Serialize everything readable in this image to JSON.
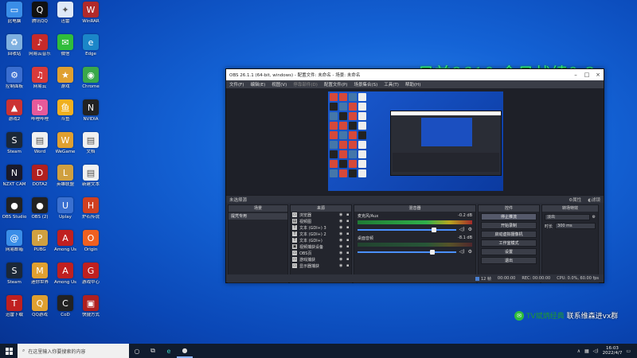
{
  "desktop_icons": [
    {
      "label": "此电脑",
      "color": "#3a8ee8",
      "glyph": "▭"
    },
    {
      "label": "腾讯QQ",
      "color": "#111111",
      "glyph": "Q"
    },
    {
      "label": "迅雷",
      "color": "#dfe9f7",
      "glyph": "✦"
    },
    {
      "label": "WinRAR",
      "color": "#b12a2a",
      "glyph": "W"
    },
    {
      "label": "回收站",
      "color": "#7fb0e0",
      "glyph": "♻"
    },
    {
      "label": "网易云音乐",
      "color": "#c62a2a",
      "glyph": "♪"
    },
    {
      "label": "微信",
      "color": "#2fbd3b",
      "glyph": "✉"
    },
    {
      "label": "Edge",
      "color": "#1b86c8",
      "glyph": "e"
    },
    {
      "label": "控制面板",
      "color": "#3a6ed0",
      "glyph": "⚙"
    },
    {
      "label": "网易云",
      "color": "#d83a3a",
      "glyph": "♫"
    },
    {
      "label": "游戏",
      "color": "#e0a030",
      "glyph": "★"
    },
    {
      "label": "Chrome",
      "color": "#3aa84a",
      "glyph": "◉"
    },
    {
      "label": "游戏2",
      "color": "#cc3333",
      "glyph": "▲"
    },
    {
      "label": "哔哩哔哩",
      "color": "#e65a9a",
      "glyph": "b"
    },
    {
      "label": "斗鱼",
      "color": "#f0b020",
      "glyph": "鱼"
    },
    {
      "label": "NVIDIA",
      "color": "#222222",
      "glyph": "N"
    },
    {
      "label": "Steam",
      "color": "#1b2838",
      "glyph": "S"
    },
    {
      "label": "Word",
      "color": "#f0f0f0",
      "glyph": "▤"
    },
    {
      "label": "WeGame",
      "color": "#e0a030",
      "glyph": "W"
    },
    {
      "label": "文档",
      "color": "#f0f0f0",
      "glyph": "▤"
    },
    {
      "label": "NZXT CAM",
      "color": "#1a1a2a",
      "glyph": "N"
    },
    {
      "label": "DOTA2",
      "color": "#b02020",
      "glyph": "D"
    },
    {
      "label": "英雄联盟",
      "color": "#d0a040",
      "glyph": "L"
    },
    {
      "label": "新建文本",
      "color": "#f0f0f0",
      "glyph": "▤"
    },
    {
      "label": "OBS Studio",
      "color": "#222222",
      "glyph": "●"
    },
    {
      "label": "OBS (2)",
      "color": "#222222",
      "glyph": "●"
    },
    {
      "label": "Uplay",
      "color": "#3a70d0",
      "glyph": "U"
    },
    {
      "label": "炉石传说",
      "color": "#d04020",
      "glyph": "H"
    },
    {
      "label": "网易邮箱",
      "color": "#3a8ee8",
      "glyph": "@"
    },
    {
      "label": "PUBG",
      "color": "#d0a040",
      "glyph": "P"
    },
    {
      "label": "Among Us",
      "color": "#c02020",
      "glyph": "A"
    },
    {
      "label": "Origin",
      "color": "#f06020",
      "glyph": "O"
    },
    {
      "label": "Steam",
      "color": "#1b2838",
      "glyph": "S"
    },
    {
      "label": "迷你世界",
      "color": "#e0a030",
      "glyph": "M"
    },
    {
      "label": "Among Us",
      "color": "#c02020",
      "glyph": "A"
    },
    {
      "label": "游戏中心",
      "color": "#c02020",
      "glyph": "G"
    },
    {
      "label": "迅雷下载",
      "color": "#c02020",
      "glyph": "T"
    },
    {
      "label": "QQ游戏",
      "color": "#e0a030",
      "glyph": "Q"
    },
    {
      "label": "CoD",
      "color": "#222222",
      "glyph": "C"
    },
    {
      "label": "快捷方式",
      "color": "#b02020",
      "glyph": "▣"
    }
  ],
  "overlay": {
    "title": "目前8610 今日战绩0-3"
  },
  "obs": {
    "window_title": "OBS 26.1.1 (64-bit, windows) - 配置文件: 未命名 - 场景: 未命名",
    "menu": [
      "文件(F)",
      "编辑(E)",
      "视图(V)",
      "停靠部件(D)",
      "配置文件(P)",
      "场景集合(S)",
      "工具(T)",
      "帮助(H)"
    ],
    "scene_bar": {
      "label": "未选择源",
      "properties": "⚙属性",
      "filters": "◐滤镜"
    },
    "docks": {
      "scenes": {
        "title": "场景",
        "items": [
          "提凭专用"
        ]
      },
      "sources": {
        "title": "来源",
        "items": [
          {
            "icon": "▭",
            "name": "浏览器"
          },
          {
            "icon": "▤",
            "name": "视频图"
          },
          {
            "icon": "T",
            "name": "文本 (GDI+) 3"
          },
          {
            "icon": "T",
            "name": "文本 (GDI+) 2"
          },
          {
            "icon": "T",
            "name": "文本 (GDI+)"
          },
          {
            "icon": "▣",
            "name": "视频捕获设备"
          },
          {
            "icon": "▭",
            "name": "OBS页"
          },
          {
            "icon": "▭",
            "name": "游戏捕获"
          },
          {
            "icon": "▭",
            "name": "显示器捕获"
          }
        ]
      },
      "mixer": {
        "title": "混音器",
        "tracks": [
          {
            "name": "麦克风/Aux",
            "level": "-0.2 dB",
            "fill": 0.62,
            "volume": 0.78
          },
          {
            "name": "桌面音频",
            "level": "-8.1 dB",
            "fill": 0.0,
            "volume": 0.76
          }
        ]
      },
      "controls": {
        "title": "控件",
        "buttons": [
          "停止推流",
          "开始录制",
          "启动虚拟摄像机",
          "工作室模式",
          "设置",
          "退出"
        ]
      },
      "transitions": {
        "title": "转场特效",
        "type": "淡出",
        "duration_label": "时长",
        "duration_value": "300 ms"
      }
    },
    "status": {
      "dropped": "12 帧",
      "live": "00:00:00",
      "rec": "REC: 00:00:00",
      "cpu": "CPU: 0.0%, 60.00 fps"
    }
  },
  "wechat": {
    "name": "TV斌炳经典",
    "text": "联系维森进vx群"
  },
  "taskbar": {
    "search_placeholder": "在这里输入你要搜索的内容",
    "time": "16:03",
    "date": "2022/4/7"
  }
}
